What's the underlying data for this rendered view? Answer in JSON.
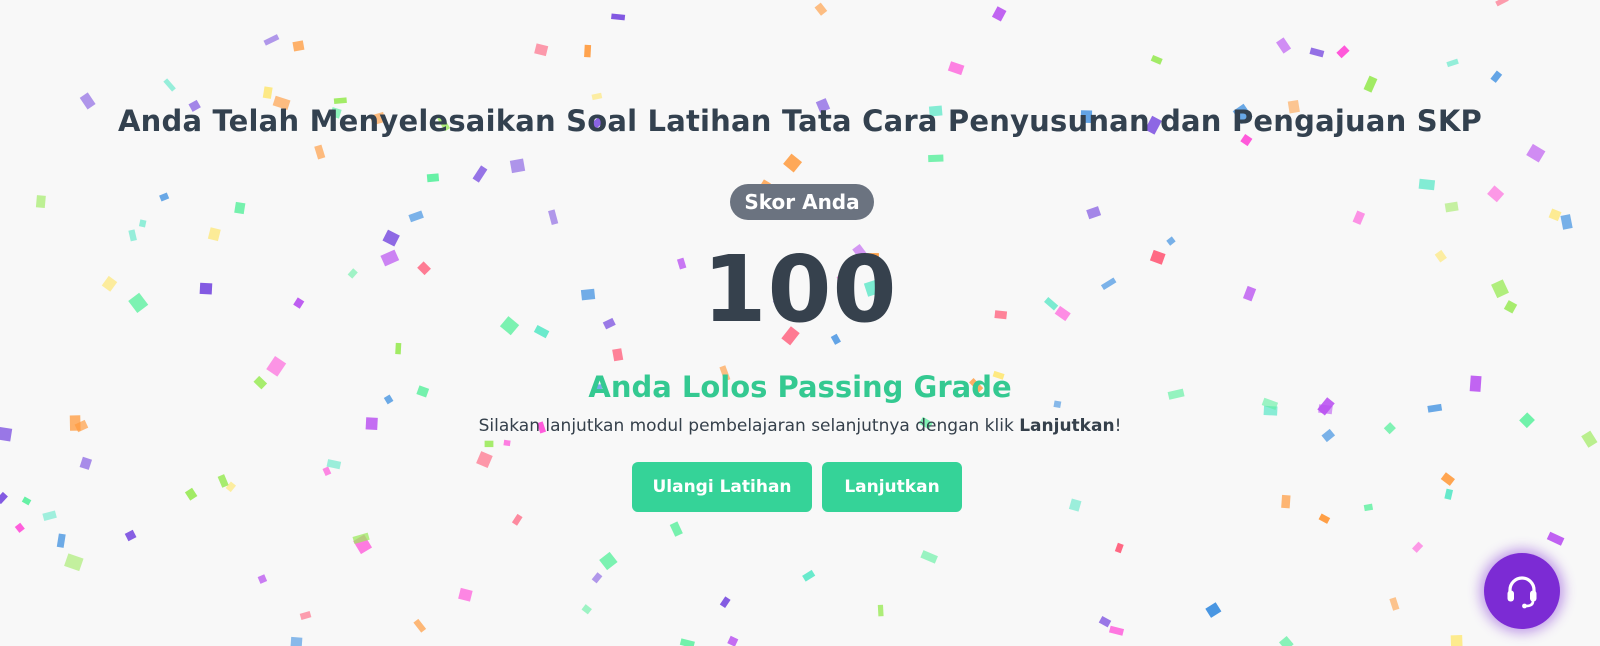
{
  "result": {
    "title": "Anda Telah Menyelesaikan Soal Latihan Tata Cara Penyusunan dan Pengajuan SKP",
    "score_label": "Skor Anda",
    "score_value": "100",
    "status": "Anda Lolos Passing Grade",
    "instruction_prefix": "Silakan lanjutkan modul pembelajaran selanjutnya dengan klik ",
    "instruction_emphasis": "Lanjutkan",
    "instruction_suffix": "!"
  },
  "actions": {
    "retry_label": "Ulangi Latihan",
    "next_label": "Lanjutkan"
  },
  "support": {
    "icon": "headset-icon",
    "color": "#7c2bd4"
  },
  "theme": {
    "accent": "#35d398",
    "status_color": "#34c991",
    "badge_color": "#6b7380",
    "background": "#f8f8f8"
  },
  "confetti": {
    "colors": [
      "#ff5d7a",
      "#5ee8c8",
      "#ff9a3c",
      "#7a4ee0",
      "#9bea5a",
      "#ff4fd8",
      "#ffe45c",
      "#3a8de0",
      "#5ef0a0",
      "#b84ef0"
    ]
  }
}
